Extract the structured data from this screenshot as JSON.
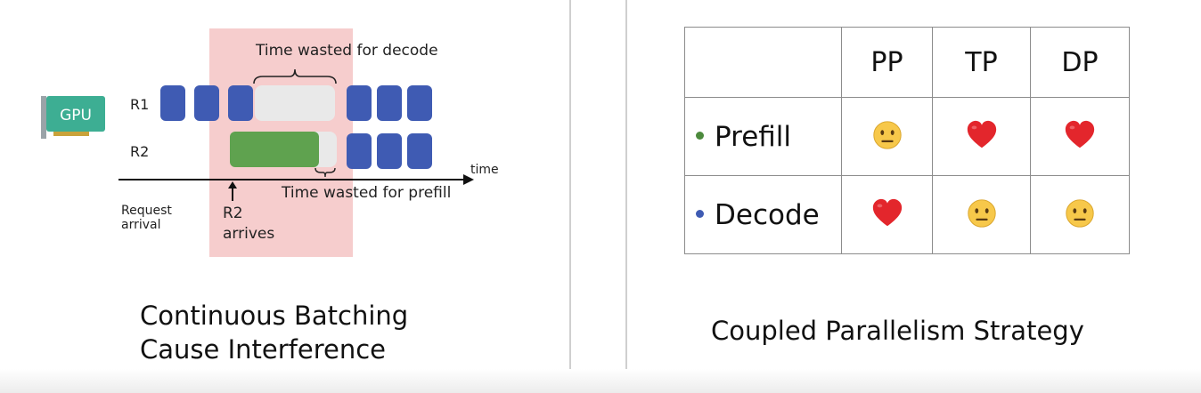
{
  "left": {
    "gpu_label": "GPU",
    "rows": [
      "R1",
      "R2"
    ],
    "caption_decode": "Time wasted for decode",
    "caption_prefill": "Time wasted for prefill",
    "axis_label": "time",
    "request_arrival": [
      "Request",
      "arrival"
    ],
    "r2_arrives": [
      "R2",
      "arrives"
    ],
    "title_lines": [
      "Continuous Batching",
      "Cause Interference"
    ]
  },
  "right": {
    "columns": [
      "PP",
      "TP",
      "DP"
    ],
    "rows": [
      {
        "label": "Prefill",
        "dot_color": "#4c8a3d",
        "cells": [
          "neutral-face-icon",
          "heart-icon",
          "heart-icon"
        ]
      },
      {
        "label": "Decode",
        "dot_color": "#3f5bb3",
        "cells": [
          "heart-icon",
          "neutral-face-icon",
          "neutral-face-icon"
        ]
      }
    ],
    "title": "Coupled Parallelism Strategy"
  },
  "colors": {
    "decode_block": "#3f5bb3",
    "prefill_block": "#5fa24f",
    "wasted_block": "#e9e9e9",
    "interference_zone": "#f4c4c4",
    "gpu_card": "#3dae93"
  }
}
